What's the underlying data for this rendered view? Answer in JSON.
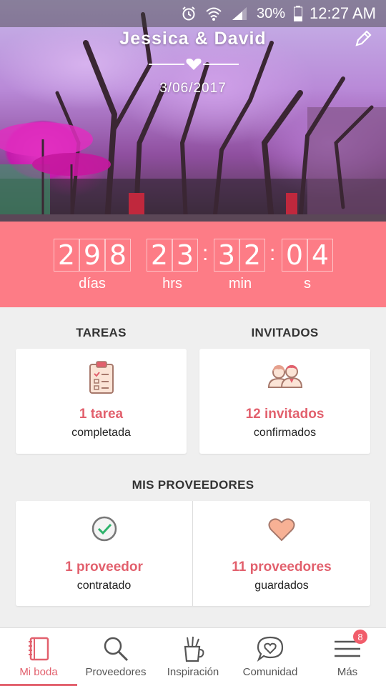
{
  "status_bar": {
    "battery": "30%",
    "time": "12:27 AM"
  },
  "hero": {
    "couple_names": "Jessica & David",
    "date": "3/06/2017"
  },
  "countdown": {
    "days": [
      "2",
      "9",
      "8"
    ],
    "hours": [
      "2",
      "3"
    ],
    "minutes": [
      "3",
      "2"
    ],
    "seconds": [
      "0",
      "4"
    ],
    "days_label": "días",
    "hours_label": "hrs",
    "minutes_label": "min",
    "seconds_label": "s"
  },
  "tasks": {
    "title": "TAREAS",
    "count": "1 tarea",
    "status": "completada"
  },
  "guests": {
    "title": "INVITADOS",
    "count": "12 invitados",
    "status": "confirmados"
  },
  "vendors": {
    "title": "MIS PROVEEDORES",
    "hired_count": "1 proveedor",
    "hired_label": "contratado",
    "saved_count": "11 proveedores",
    "saved_label": "guardados"
  },
  "nav": {
    "items": [
      {
        "label": "Mi boda",
        "icon": "notebook-icon",
        "active": true
      },
      {
        "label": "Proveedores",
        "icon": "search-icon"
      },
      {
        "label": "Inspiración",
        "icon": "pencil-cup-icon"
      },
      {
        "label": "Comunidad",
        "icon": "chat-heart-icon"
      },
      {
        "label": "Más",
        "icon": "menu-icon"
      }
    ],
    "more_badge": "8"
  },
  "colors": {
    "accent": "#fd7c86",
    "text_accent": "#e2606d"
  }
}
